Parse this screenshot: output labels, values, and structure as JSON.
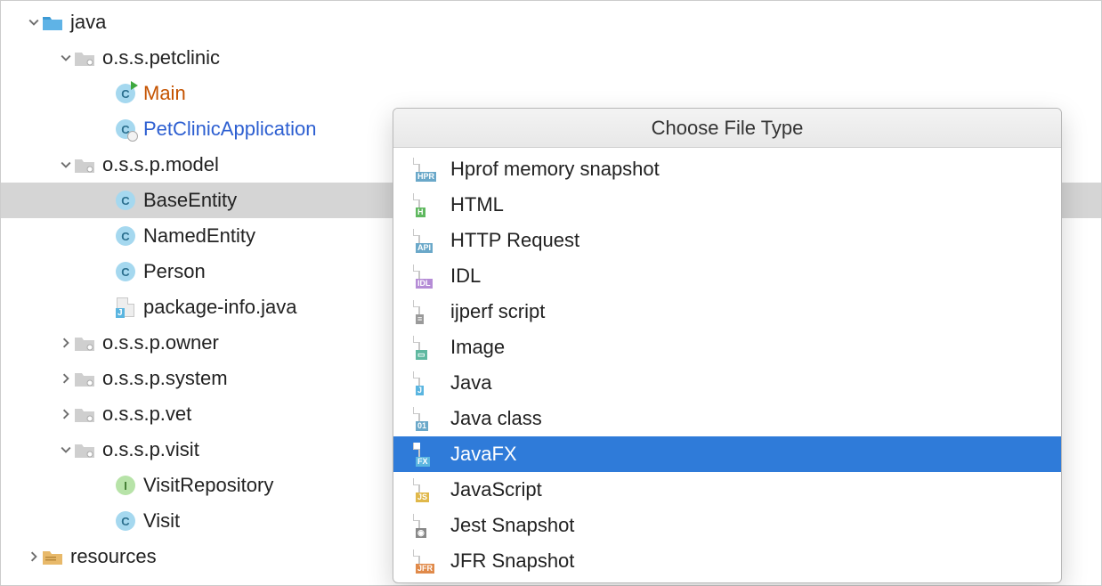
{
  "tree": {
    "java": "java",
    "petclinic": "o.s.s.petclinic",
    "main": "Main",
    "app": "PetClinicApplication",
    "model": "o.s.s.p.model",
    "baseEntity": "BaseEntity",
    "namedEntity": "NamedEntity",
    "person": "Person",
    "packageInfo": "package-info.java",
    "owner": "o.s.s.p.owner",
    "system": "o.s.s.p.system",
    "vet": "o.s.s.p.vet",
    "visit": "o.s.s.p.visit",
    "visitRepository": "VisitRepository",
    "visitClass": "Visit",
    "resources": "resources"
  },
  "popup": {
    "title": "Choose File Type",
    "items": [
      {
        "label": "Hprof memory snapshot",
        "badge": "HPR",
        "badgeColor": "#6aa8c9",
        "selected": false
      },
      {
        "label": "HTML",
        "badge": "H",
        "badgeColor": "#5fb85f",
        "selected": false
      },
      {
        "label": "HTTP Request",
        "badge": "API",
        "badgeColor": "#6aa8c9",
        "selected": false
      },
      {
        "label": "IDL",
        "badge": "IDL",
        "badgeColor": "#b58cd6",
        "selected": false
      },
      {
        "label": "ijperf script",
        "badge": "≡",
        "badgeColor": "#9a9a9a",
        "selected": false
      },
      {
        "label": "Image",
        "badge": "▭",
        "badgeColor": "#5fb8a0",
        "selected": false
      },
      {
        "label": "Java",
        "badge": "J",
        "badgeColor": "#5ab5e0",
        "selected": false
      },
      {
        "label": "Java class",
        "badge": "01",
        "badgeColor": "#6aa8c9",
        "selected": false
      },
      {
        "label": "JavaFX",
        "badge": "FX",
        "badgeColor": "#5ab5e0",
        "selected": true
      },
      {
        "label": "JavaScript",
        "badge": "JS",
        "badgeColor": "#e0b84a",
        "selected": false
      },
      {
        "label": "Jest Snapshot",
        "badge": "◉",
        "badgeColor": "#888",
        "selected": false
      },
      {
        "label": "JFR Snapshot",
        "badge": "JFR",
        "badgeColor": "#e08a4a",
        "selected": false
      }
    ]
  }
}
